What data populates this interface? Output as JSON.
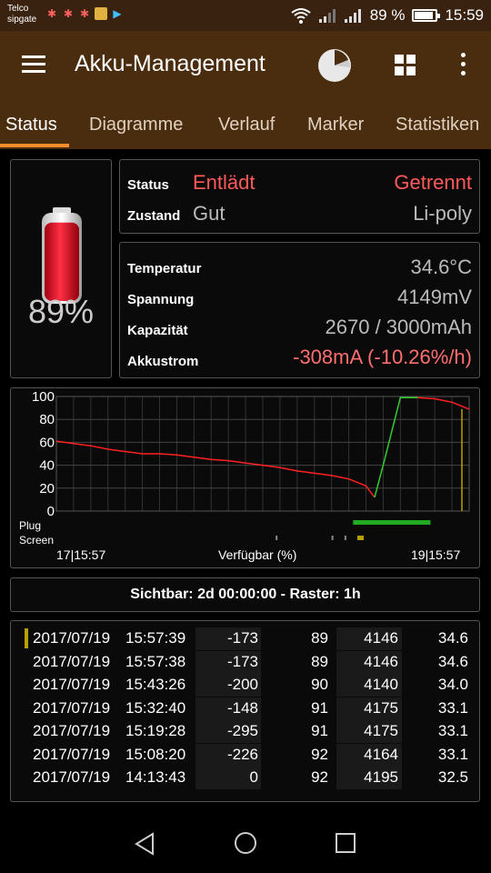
{
  "status_bar": {
    "carrier_line1": "Telco",
    "carrier_line2": "sipgate",
    "battery_text": "89 %",
    "time": "15:59"
  },
  "app_bar": {
    "title": "Akku-Management",
    "icons": [
      "menu-icon",
      "pie-chart-icon",
      "grid-icon",
      "more-icon"
    ]
  },
  "tabs": [
    {
      "label": "Status",
      "active": true
    },
    {
      "label": "Diagramme",
      "active": false
    },
    {
      "label": "Verlauf",
      "active": false
    },
    {
      "label": "Marker",
      "active": false
    },
    {
      "label": "Statistiken",
      "active": false
    }
  ],
  "battery": {
    "percent_text": "89%",
    "level": 0.89
  },
  "status_panel": {
    "status_label": "Status",
    "status_value": "Entlädt",
    "plug_value": "Getrennt",
    "zustand_label": "Zustand",
    "zustand_value": "Gut",
    "type_value": "Li-poly"
  },
  "details_panel": {
    "temperatur_label": "Temperatur",
    "temperatur_value": "34.6°C",
    "spannung_label": "Spannung",
    "spannung_value": "4149mV",
    "kapazitaet_label": "Kapazität",
    "kapazitaet_value": "2670 / 3000mAh",
    "akkustrom_label": "Akkustrom",
    "akkustrom_value": "-308mA (-10.26%/h)"
  },
  "chart_data": {
    "type": "line",
    "y_ticks": [
      "100",
      "80",
      "60",
      "40",
      "20",
      "0"
    ],
    "ylim": [
      0,
      100
    ],
    "x_start_label": "17|15:57",
    "x_end_label": "19|15:57",
    "xlabel": "Verfügbar (%)",
    "row_labels": [
      "Plug",
      "Screen"
    ],
    "series": [
      {
        "color_discharge": "#ff2020",
        "color_charge": "#33cc33",
        "x_hours": [
          0,
          2,
          4,
          6,
          8,
          10,
          12,
          14,
          16,
          18,
          20,
          22,
          24,
          26,
          28,
          30,
          32,
          34,
          36,
          37,
          38,
          40,
          42,
          44,
          46,
          48
        ],
        "values": [
          61,
          59,
          57,
          54,
          52,
          50,
          50,
          49,
          47,
          45,
          44,
          42,
          40,
          38,
          35,
          33,
          31,
          28,
          22,
          12,
          40,
          99,
          99,
          98,
          95,
          89
        ]
      }
    ],
    "end_marker_value": 89,
    "plug_bar_hours": [
      34.5,
      43.5
    ],
    "screen_marks_hours": [
      25.5,
      32,
      33.5,
      35
    ]
  },
  "sichtbar_text": "Sichtbar: 2d 00:00:00 - Raster: 1h",
  "history": {
    "rows": [
      {
        "date": "2017/07/19",
        "time": "15:57:39",
        "current": "-173",
        "percent": "89",
        "voltage": "4146",
        "temp": "34.6"
      },
      {
        "date": "2017/07/19",
        "time": "15:57:38",
        "current": "-173",
        "percent": "89",
        "voltage": "4146",
        "temp": "34.6"
      },
      {
        "date": "2017/07/19",
        "time": "15:43:26",
        "current": "-200",
        "percent": "90",
        "voltage": "4140",
        "temp": "34.0"
      },
      {
        "date": "2017/07/19",
        "time": "15:32:40",
        "current": "-148",
        "percent": "91",
        "voltage": "4175",
        "temp": "33.1"
      },
      {
        "date": "2017/07/19",
        "time": "15:19:28",
        "current": "-295",
        "percent": "91",
        "voltage": "4175",
        "temp": "33.1"
      },
      {
        "date": "2017/07/19",
        "time": "15:08:20",
        "current": "-226",
        "percent": "92",
        "voltage": "4164",
        "temp": "33.1"
      },
      {
        "date": "2017/07/19",
        "time": "14:13:43",
        "current": "0",
        "percent": "92",
        "voltage": "4195",
        "temp": "32.5"
      }
    ]
  },
  "nav_bar": {
    "icons": [
      "back-icon",
      "home-icon",
      "recents-icon"
    ]
  }
}
